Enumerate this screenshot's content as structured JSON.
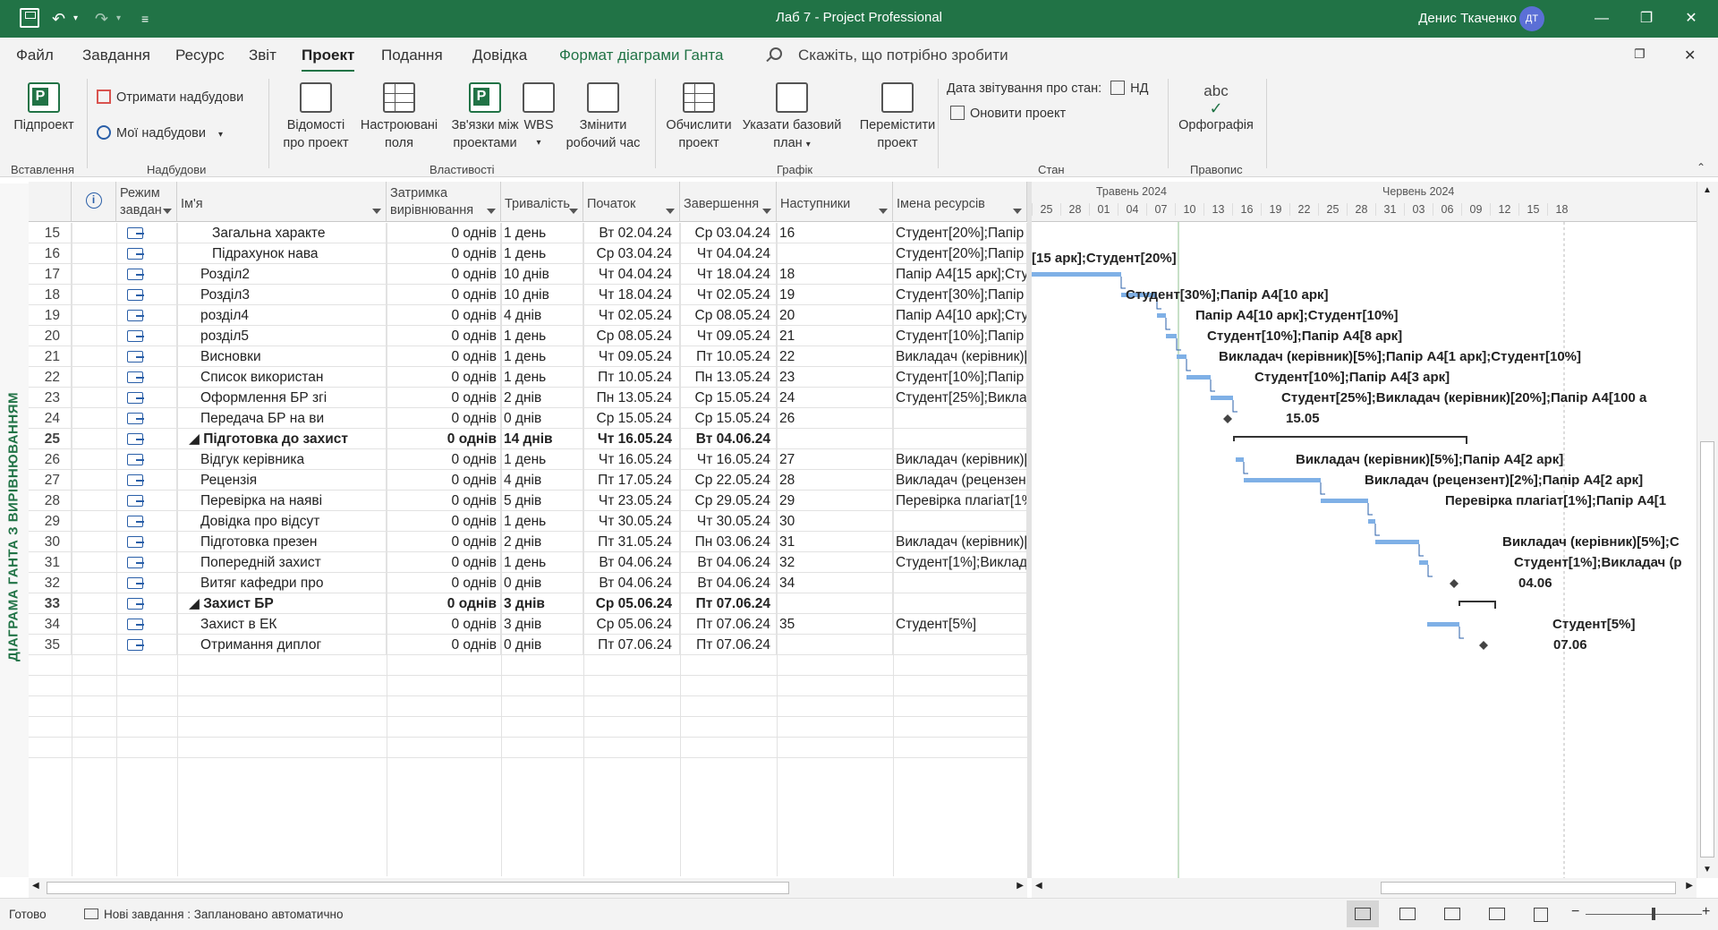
{
  "window": {
    "title": "Лаб 7  -  Project Professional",
    "user_name": "Денис Ткаченко",
    "user_initials": "ДТ"
  },
  "menu": {
    "tabs": [
      "Файл",
      "Завдання",
      "Ресурс",
      "Звіт",
      "Проект",
      "Подання",
      "Довідка",
      "Формат діаграми Ганта"
    ],
    "search_placeholder": "Скажіть, що потрібно зробити"
  },
  "ribbon": {
    "subproject": "Підпроект",
    "get_addins": "Отримати надбудови",
    "my_addins": "Мої надбудови",
    "project_info": [
      "Відомості",
      "про проект"
    ],
    "custom_fields": [
      "Настроювані",
      "поля"
    ],
    "links": [
      "Зв'язки між",
      "проектами"
    ],
    "wbs": "WBS",
    "change_time": [
      "Змінити",
      "робочий час"
    ],
    "calc": [
      "Обчислити",
      "проект"
    ],
    "baseline": [
      "Указати базовий",
      "план"
    ],
    "move": [
      "Перемістити",
      "проект"
    ],
    "status_date_label": "Дата звітування про стан:",
    "status_date_value": "НД",
    "update": "Оновити проект",
    "spelling": "Орфографія",
    "groups": [
      "Вставлення",
      "Надбудови",
      "Властивості",
      "Графік",
      "Стан",
      "Правопис"
    ]
  },
  "side_label": "ДІАГРАМА ГАНТА З ВИРІВНЮВАННЯМ",
  "columns": {
    "mode": [
      "Режим",
      "завдан"
    ],
    "name": "Ім'я",
    "lev": [
      "Затримка",
      "вирівнювання"
    ],
    "dur": "Тривалість",
    "start": "Початок",
    "fin": "Завершення",
    "succ": "Наступники",
    "res": "Імена ресурсів"
  },
  "rows": [
    {
      "id": "15",
      "name": "Загальна характе",
      "lev": "0 однів",
      "dur": "1 день",
      "start": "Вт 02.04.24",
      "fin": "Ср 03.04.24",
      "succ": "16",
      "res": "Студент[20%];Папір А",
      "indent": 3
    },
    {
      "id": "16",
      "name": "Підрахунок нава",
      "lev": "0 однів",
      "dur": "1 день",
      "start": "Ср 03.04.24",
      "fin": "Чт 04.04.24",
      "succ": "",
      "res": "Студент[20%];Папір А",
      "indent": 3
    },
    {
      "id": "17",
      "name": "Розділ2",
      "lev": "0 однів",
      "dur": "10 днів",
      "start": "Чт 04.04.24",
      "fin": "Чт 18.04.24",
      "succ": "18",
      "res": "Папір А4[15 арк];Сту",
      "indent": 2
    },
    {
      "id": "18",
      "name": "Розділ3",
      "lev": "0 однів",
      "dur": "10 днів",
      "start": "Чт 18.04.24",
      "fin": "Чт 02.05.24",
      "succ": "19",
      "res": "Студент[30%];Папір А",
      "indent": 2
    },
    {
      "id": "19",
      "name": "розділ4",
      "lev": "0 однів",
      "dur": "4 днів",
      "start": "Чт 02.05.24",
      "fin": "Ср 08.05.24",
      "succ": "20",
      "res": "Папір А4[10 арк];Сту",
      "indent": 2
    },
    {
      "id": "20",
      "name": "розділ5",
      "lev": "0 однів",
      "dur": "1 день",
      "start": "Ср 08.05.24",
      "fin": "Чт 09.05.24",
      "succ": "21",
      "res": "Студент[10%];Папір А",
      "indent": 2
    },
    {
      "id": "21",
      "name": "Висновки",
      "lev": "0 однів",
      "dur": "1 день",
      "start": "Чт 09.05.24",
      "fin": "Пт 10.05.24",
      "succ": "22",
      "res": "Викладач (керівник)[",
      "indent": 2
    },
    {
      "id": "22",
      "name": "Список використан",
      "lev": "0 однів",
      "dur": "1 день",
      "start": "Пт 10.05.24",
      "fin": "Пн 13.05.24",
      "succ": "23",
      "res": "Студент[10%];Папір А",
      "indent": 2
    },
    {
      "id": "23",
      "name": "Оформлення БР згі",
      "lev": "0 однів",
      "dur": "2 днів",
      "start": "Пн 13.05.24",
      "fin": "Ср 15.05.24",
      "succ": "24",
      "res": "Студент[25%];Виклад",
      "indent": 2
    },
    {
      "id": "24",
      "name": "Передача БР на ви",
      "lev": "0 однів",
      "dur": "0 днів",
      "start": "Ср 15.05.24",
      "fin": "Ср 15.05.24",
      "succ": "26",
      "res": "",
      "indent": 2
    },
    {
      "id": "25",
      "name": "◢ Підготовка до захист",
      "lev": "0 однів",
      "dur": "14 днів",
      "start": "Чт 16.05.24",
      "fin": "Вт 04.06.24",
      "succ": "",
      "res": "",
      "indent": 1,
      "bold": true
    },
    {
      "id": "26",
      "name": "Відгук керівника",
      "lev": "0 однів",
      "dur": "1 день",
      "start": "Чт 16.05.24",
      "fin": "Чт 16.05.24",
      "succ": "27",
      "res": "Викладач (керівник)[",
      "indent": 2
    },
    {
      "id": "27",
      "name": "Рецензія",
      "lev": "0 однів",
      "dur": "4 днів",
      "start": "Пт 17.05.24",
      "fin": "Ср 22.05.24",
      "succ": "28",
      "res": "Викладач (рецензент",
      "indent": 2
    },
    {
      "id": "28",
      "name": "Перевірка на наяві",
      "lev": "0 однів",
      "dur": "5 днів",
      "start": "Чт 23.05.24",
      "fin": "Ср 29.05.24",
      "succ": "29",
      "res": "Перевірка плагіат[1%",
      "indent": 2
    },
    {
      "id": "29",
      "name": "Довідка про відсут",
      "lev": "0 однів",
      "dur": "1 день",
      "start": "Чт 30.05.24",
      "fin": "Чт 30.05.24",
      "succ": "30",
      "res": "",
      "indent": 2
    },
    {
      "id": "30",
      "name": "Підготовка презен",
      "lev": "0 однів",
      "dur": "2 днів",
      "start": "Пт 31.05.24",
      "fin": "Пн 03.06.24",
      "succ": "31",
      "res": "Викладач (керівник)[",
      "indent": 2
    },
    {
      "id": "31",
      "name": "Попередній захист",
      "lev": "0 однів",
      "dur": "1 день",
      "start": "Вт 04.06.24",
      "fin": "Вт 04.06.24",
      "succ": "32",
      "res": "Студент[1%];Виклад",
      "indent": 2
    },
    {
      "id": "32",
      "name": "Витяг кафедри про",
      "lev": "0 однів",
      "dur": "0 днів",
      "start": "Вт 04.06.24",
      "fin": "Вт 04.06.24",
      "succ": "34",
      "res": "",
      "indent": 2
    },
    {
      "id": "33",
      "name": "◢ Захист БР",
      "lev": "0 однів",
      "dur": "3 днів",
      "start": "Ср 05.06.24",
      "fin": "Пт 07.06.24",
      "succ": "",
      "res": "",
      "indent": 1,
      "bold": true
    },
    {
      "id": "34",
      "name": "Захист в ЕК",
      "lev": "0 однів",
      "dur": "3 днів",
      "start": "Ср 05.06.24",
      "fin": "Пт 07.06.24",
      "succ": "35",
      "res": "Студент[5%]",
      "indent": 2
    },
    {
      "id": "35",
      "name": "Отримання диплог",
      "lev": "0 однів",
      "dur": "0 днів",
      "start": "Пт 07.06.24",
      "fin": "Пт 07.06.24",
      "succ": "",
      "res": "",
      "indent": 2
    }
  ],
  "timescale": {
    "months": [
      {
        "label": "Травень 2024"
      },
      {
        "label": "Червень 2024"
      }
    ],
    "days": [
      "25",
      "28",
      "01",
      "04",
      "07",
      "10",
      "13",
      "16",
      "19",
      "22",
      "25",
      "28",
      "31",
      "03",
      "06",
      "09",
      "12",
      "15",
      "18"
    ]
  },
  "gantt_labels": [
    {
      "text": "[15 арк];Студент[20%]"
    },
    {
      "text": "Студент[30%];Папір А4[10 арк]"
    },
    {
      "text": "Папір А4[10 арк];Студент[10%]"
    },
    {
      "text": "Студент[10%];Папір А4[8 арк]"
    },
    {
      "text": "Викладач (керівник)[5%];Папір А4[1 арк];Студент[10%]"
    },
    {
      "text": "Студент[10%];Папір А4[3 арк]"
    },
    {
      "text": "Студент[25%];Викладач (керівник)[20%];Папір А4[100 а"
    },
    {
      "text": "15.05"
    },
    {
      "text": "Викладач (керівник)[5%];Папір А4[2 арк]"
    },
    {
      "text": "Викладач (рецензент)[2%];Папір А4[2 арк]"
    },
    {
      "text": "Перевірка плагіат[1%];Папір А4[1"
    },
    {
      "text": "Викладач (керівник)[5%];С"
    },
    {
      "text": "Студент[1%];Викладач (р"
    },
    {
      "text": "04.06"
    },
    {
      "text": "Студент[5%]"
    },
    {
      "text": "07.06"
    }
  ],
  "status": {
    "ready": "Готово",
    "new_tasks": "Нові завдання : Заплановано автоматично"
  },
  "colors": {
    "accent": "#217346",
    "bar": "#7fb0e6"
  }
}
